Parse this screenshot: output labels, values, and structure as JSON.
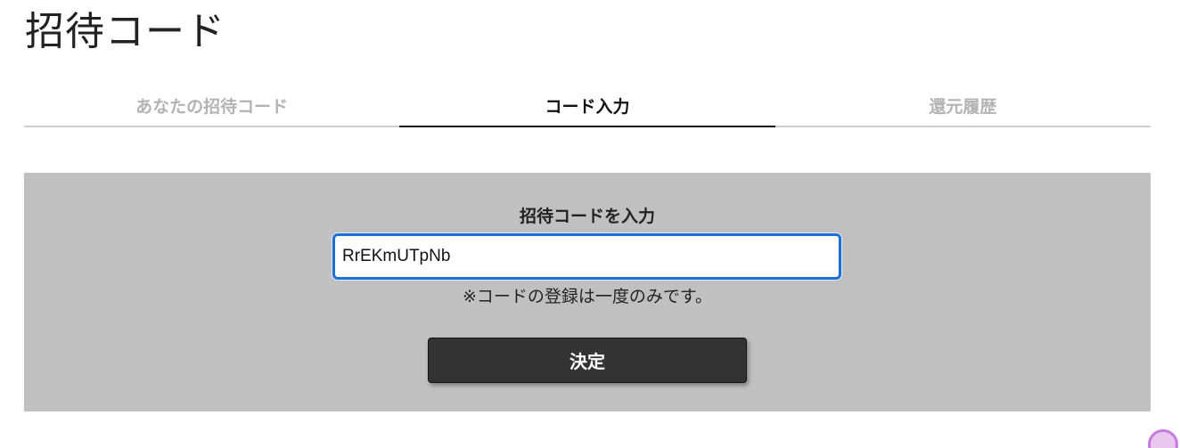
{
  "page": {
    "title": "招待コード"
  },
  "tabs": [
    {
      "label": "あなたの招待コード",
      "active": false
    },
    {
      "label": "コード入力",
      "active": true
    },
    {
      "label": "還元履歴",
      "active": false
    }
  ],
  "form": {
    "label": "招待コードを入力",
    "input_value": "RrEKmUTpNb",
    "note": "※コードの登録は一度のみです。",
    "submit_label": "決定"
  },
  "colors": {
    "panel_bg": "#c0c0c0",
    "button_bg": "#333333",
    "input_focus_border": "#1a6fd6",
    "inactive_tab": "#b3b3b3"
  }
}
